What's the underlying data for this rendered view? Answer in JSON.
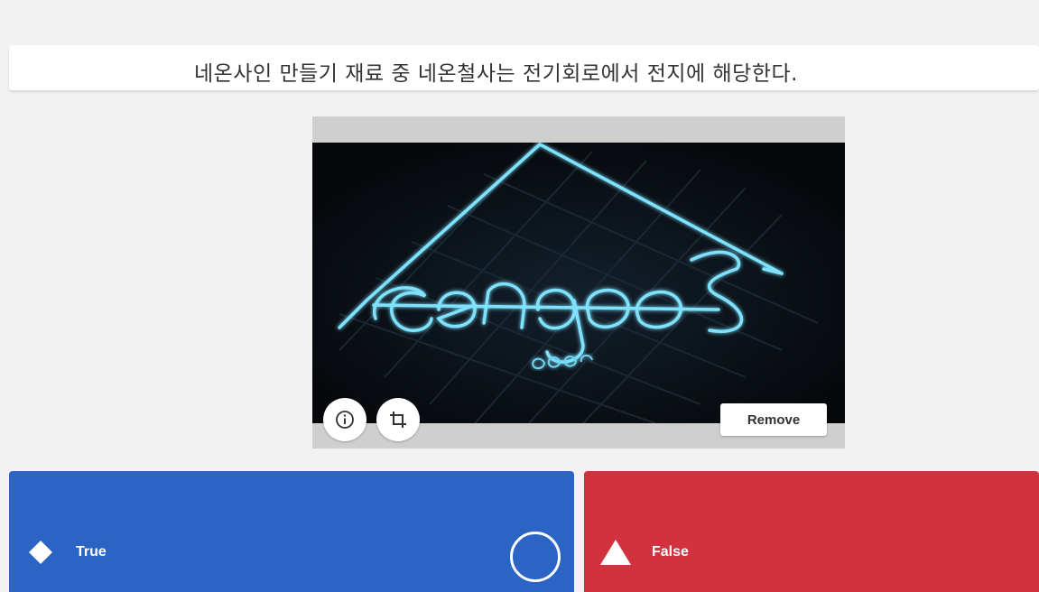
{
  "question": {
    "text": "네온사인 만들기 재료 중 네온철사는 전기회로에서 전지에 해당한다."
  },
  "media": {
    "icons": [
      "info-icon",
      "crop-icon"
    ],
    "remove_label": "Remove",
    "glow_color": "#7fe3ff"
  },
  "answers": [
    {
      "label": "True",
      "shape": "diamond-icon",
      "color": "#2c64c5",
      "selected_indicator": "circle"
    },
    {
      "label": "False",
      "shape": "triangle-icon",
      "color": "#d1323e"
    }
  ]
}
